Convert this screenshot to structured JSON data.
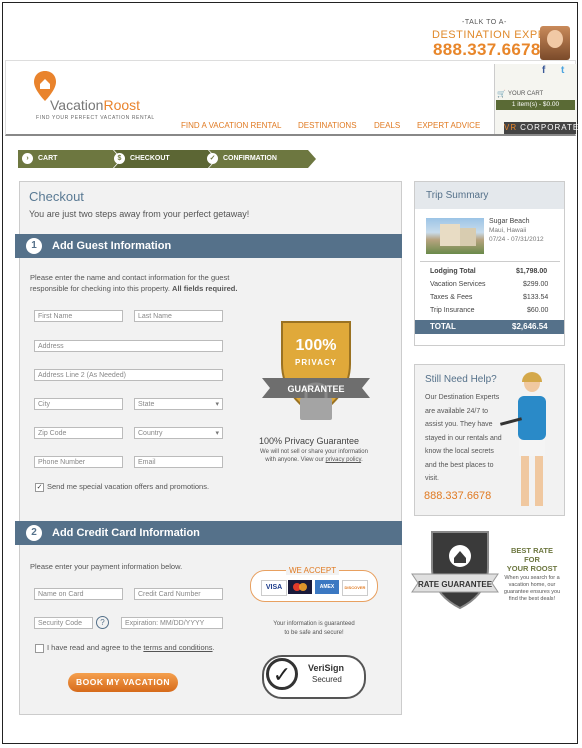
{
  "top": {
    "talk_to": "-TALK TO A-",
    "destination_expert": "DESTINATION EXPERT",
    "phone": "888.337.6678"
  },
  "brand": {
    "name_part1": "Vacation",
    "name_part2": "Roost",
    "tagline": "FIND YOUR PERFECT VACATION RENTAL"
  },
  "nav": [
    "FIND A VACATION RENTAL",
    "DESTINATIONS",
    "DEALS",
    "EXPERT ADVICE"
  ],
  "social": {
    "facebook": "f",
    "twitter": "t"
  },
  "cart": {
    "label": "YOUR CART",
    "summary": "1 item(s) - $0.00",
    "corporate": "CORPORATE",
    "corporate_prefix": "VR"
  },
  "steps": [
    "CART",
    "CHECKOUT",
    "CONFIRMATION"
  ],
  "checkout": {
    "title": "Checkout",
    "subtitle": "You are just two steps away from your perfect getaway!",
    "guest": {
      "num": "1",
      "title": "Add Guest Information",
      "instructions_1": "Please enter the name and contact information for the guest",
      "instructions_2": "responsible for checking into this property.",
      "instructions_bold": "All fields required.",
      "fields": {
        "first_name": "First Name",
        "last_name": "Last Name",
        "address": "Address",
        "address2": "Address Line 2 (As Needed)",
        "city": "City",
        "state": "State",
        "zip": "Zip Code",
        "country": "Country",
        "phone": "Phone Number",
        "email": "Email"
      },
      "offers_label": "Send me special vacation offers and promotions."
    },
    "privacy": {
      "pct": "100%",
      "word": "PRIVACY",
      "ribbon": "GUARANTEE",
      "title": "100% Privacy Guarantee",
      "copy_1": "We will not sell or share your information",
      "copy_2": "with anyone. View our",
      "link": "privacy policy",
      "copy_end": "."
    },
    "card": {
      "num": "2",
      "title": "Add Credit Card Information",
      "instructions": "Please enter your payment information below.",
      "fields": {
        "name": "Name on Card",
        "number": "Credit Card Number",
        "code": "Security Code",
        "help": "?",
        "exp": "Expiration: MM/DD/YYYY"
      },
      "agree_prefix": "I have read and agree to the",
      "agree_link": "terms and conditions",
      "agree_end": ".",
      "we_accept": "WE ACCEPT",
      "cards": [
        "VISA",
        "MC",
        "AMEX",
        "DISCOVER"
      ],
      "safe_1": "Your information is guaranteed",
      "safe_2": "to be safe and secure!",
      "verisign_1": "VeriSign",
      "verisign_2": "Secured",
      "button": "BOOK MY VACATION"
    }
  },
  "trip": {
    "title": "Trip Summary",
    "property": "Sugar Beach",
    "location": "Maui, Hawaii",
    "dates": "07/24 - 07/31/2012",
    "lines": [
      {
        "label": "Lodging Total",
        "value": "$1,798.00",
        "bold": true
      },
      {
        "label": "Vacation Services",
        "value": "$299.00",
        "bold": false
      },
      {
        "label": "Taxes & Fees",
        "value": "$133.54",
        "bold": false
      },
      {
        "label": "Trip Insurance",
        "value": "$60.00",
        "bold": false
      }
    ],
    "total_label": "TOTAL",
    "total_value": "$2,646.54"
  },
  "help": {
    "title": "Still Need Help?",
    "copy": "Our Destination Experts are available 24/7 to assist you. They have stayed in our rentals and know the local secrets and the best places to visit.",
    "phone": "888.337.6678"
  },
  "rate": {
    "ribbon": "RATE GUARANTEE",
    "best_1": "BEST RATE FOR",
    "best_2": "YOUR ROOST",
    "copy_1": "When you search for a",
    "copy_2": "vacation home, our",
    "copy_3": "guarantee ensures you",
    "copy_4": "find the best deals!"
  },
  "colors": {
    "accent": "#e8862a",
    "steel": "#55718a",
    "olive": "#6d7740"
  }
}
